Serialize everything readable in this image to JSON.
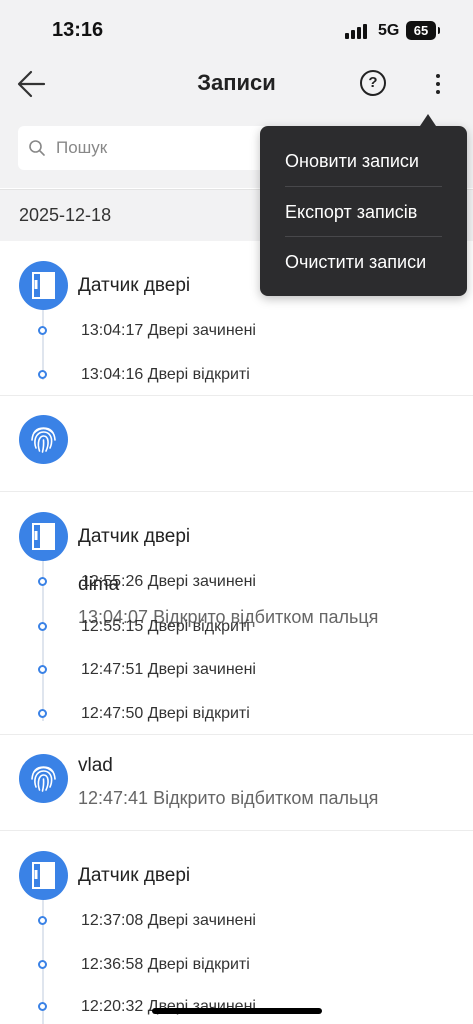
{
  "status_bar": {
    "time": "13:16",
    "network": "5G",
    "battery": "65"
  },
  "header": {
    "title": "Записи",
    "help_symbol": "?"
  },
  "search": {
    "placeholder": "Пошук"
  },
  "date_header": "2025-12-18",
  "menu": {
    "items": [
      "Оновити записи",
      "Експорт записів",
      "Очистити записи"
    ]
  },
  "groups": [
    {
      "type": "door",
      "icon": "door-sensor-icon",
      "title": "Датчик двері",
      "events": [
        "13:04:17 Двері зачинені",
        "13:04:16 Двері відкриті"
      ]
    },
    {
      "type": "user",
      "icon": "fingerprint-icon",
      "title": "dima",
      "detail": "13:04:07 Відкрито відбитком пальця"
    },
    {
      "type": "door",
      "icon": "door-sensor-icon",
      "title": "Датчик двері",
      "events": [
        "12:55:26 Двері зачинені",
        "12:55:15 Двері відкриті",
        "12:47:51 Двері зачинені",
        "12:47:50 Двері відкриті"
      ]
    },
    {
      "type": "user",
      "icon": "fingerprint-icon",
      "title": "vlad",
      "detail": "12:47:41 Відкрито відбитком пальця"
    },
    {
      "type": "door",
      "icon": "door-sensor-icon",
      "title": "Датчик двері",
      "events": [
        "12:37:08 Двері зачинені",
        "12:36:58 Двері відкриті",
        "12:20:32 Двері зачинені"
      ]
    }
  ],
  "colors": {
    "accent": "#3a82e6",
    "menu_bg": "#2c2c2e",
    "header_bg": "#f2f2f3"
  }
}
